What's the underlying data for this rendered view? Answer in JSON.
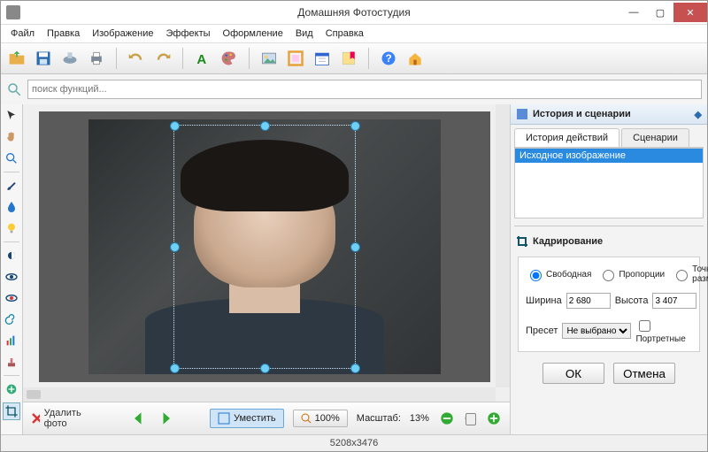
{
  "window": {
    "title": "Домашняя Фотостудия"
  },
  "menu": [
    "Файл",
    "Правка",
    "Изображение",
    "Эффекты",
    "Оформление",
    "Вид",
    "Справка"
  ],
  "search": {
    "placeholder": "поиск функций..."
  },
  "toolbar_icons": [
    "open",
    "save",
    "save-as",
    "print",
    "undo",
    "redo",
    "text",
    "palette",
    "image-insert",
    "frame",
    "calendar",
    "bookmark",
    "help",
    "home"
  ],
  "left_tools": [
    "cursor",
    "hand",
    "zoom",
    "brush",
    "drop",
    "bulb",
    "brightness",
    "eye",
    "redeye",
    "swirl",
    "levels",
    "stamp",
    "healing",
    "crop"
  ],
  "history": {
    "panel_title": "История и сценарии",
    "tab_history": "История действий",
    "tab_scenarios": "Сценарии",
    "items": [
      "Исходное изображение"
    ]
  },
  "crop": {
    "panel_title": "Кадрирование",
    "mode_free": "Свободная",
    "mode_prop": "Пропорции",
    "mode_exact": "Точный размер",
    "width_label": "Ширина",
    "width_value": "2 680",
    "height_label": "Высота",
    "height_value": "3 407",
    "preset_label": "Пресет",
    "preset_value": "Не выбрано",
    "portrait_label": "Портретные",
    "ok": "ОК",
    "cancel": "Отмена"
  },
  "bottom": {
    "delete": "Удалить фото",
    "fit": "Уместить",
    "p100": "100%",
    "scale_label": "Масштаб:",
    "scale_value": "13%"
  },
  "status": {
    "dims": "5208x3476"
  }
}
